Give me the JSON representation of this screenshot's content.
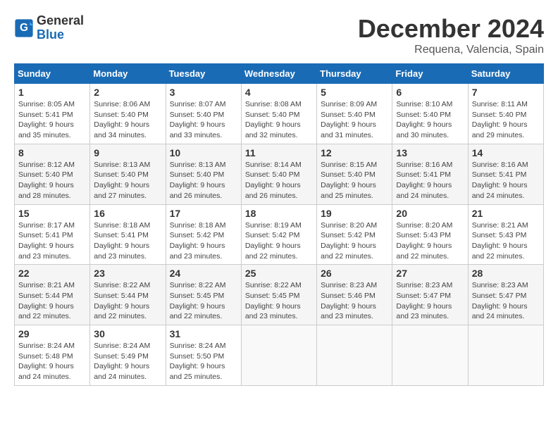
{
  "header": {
    "logo_line1": "General",
    "logo_line2": "Blue",
    "month_title": "December 2024",
    "location": "Requena, Valencia, Spain"
  },
  "calendar": {
    "days_of_week": [
      "Sunday",
      "Monday",
      "Tuesday",
      "Wednesday",
      "Thursday",
      "Friday",
      "Saturday"
    ],
    "weeks": [
      [
        {
          "day": "1",
          "sunrise": "8:05 AM",
          "sunset": "5:41 PM",
          "daylight": "9 hours and 35 minutes."
        },
        {
          "day": "2",
          "sunrise": "8:06 AM",
          "sunset": "5:40 PM",
          "daylight": "9 hours and 34 minutes."
        },
        {
          "day": "3",
          "sunrise": "8:07 AM",
          "sunset": "5:40 PM",
          "daylight": "9 hours and 33 minutes."
        },
        {
          "day": "4",
          "sunrise": "8:08 AM",
          "sunset": "5:40 PM",
          "daylight": "9 hours and 32 minutes."
        },
        {
          "day": "5",
          "sunrise": "8:09 AM",
          "sunset": "5:40 PM",
          "daylight": "9 hours and 31 minutes."
        },
        {
          "day": "6",
          "sunrise": "8:10 AM",
          "sunset": "5:40 PM",
          "daylight": "9 hours and 30 minutes."
        },
        {
          "day": "7",
          "sunrise": "8:11 AM",
          "sunset": "5:40 PM",
          "daylight": "9 hours and 29 minutes."
        }
      ],
      [
        {
          "day": "8",
          "sunrise": "8:12 AM",
          "sunset": "5:40 PM",
          "daylight": "9 hours and 28 minutes."
        },
        {
          "day": "9",
          "sunrise": "8:13 AM",
          "sunset": "5:40 PM",
          "daylight": "9 hours and 27 minutes."
        },
        {
          "day": "10",
          "sunrise": "8:13 AM",
          "sunset": "5:40 PM",
          "daylight": "9 hours and 26 minutes."
        },
        {
          "day": "11",
          "sunrise": "8:14 AM",
          "sunset": "5:40 PM",
          "daylight": "9 hours and 26 minutes."
        },
        {
          "day": "12",
          "sunrise": "8:15 AM",
          "sunset": "5:40 PM",
          "daylight": "9 hours and 25 minutes."
        },
        {
          "day": "13",
          "sunrise": "8:16 AM",
          "sunset": "5:41 PM",
          "daylight": "9 hours and 24 minutes."
        },
        {
          "day": "14",
          "sunrise": "8:16 AM",
          "sunset": "5:41 PM",
          "daylight": "9 hours and 24 minutes."
        }
      ],
      [
        {
          "day": "15",
          "sunrise": "8:17 AM",
          "sunset": "5:41 PM",
          "daylight": "9 hours and 23 minutes."
        },
        {
          "day": "16",
          "sunrise": "8:18 AM",
          "sunset": "5:41 PM",
          "daylight": "9 hours and 23 minutes."
        },
        {
          "day": "17",
          "sunrise": "8:18 AM",
          "sunset": "5:42 PM",
          "daylight": "9 hours and 23 minutes."
        },
        {
          "day": "18",
          "sunrise": "8:19 AM",
          "sunset": "5:42 PM",
          "daylight": "9 hours and 22 minutes."
        },
        {
          "day": "19",
          "sunrise": "8:20 AM",
          "sunset": "5:42 PM",
          "daylight": "9 hours and 22 minutes."
        },
        {
          "day": "20",
          "sunrise": "8:20 AM",
          "sunset": "5:43 PM",
          "daylight": "9 hours and 22 minutes."
        },
        {
          "day": "21",
          "sunrise": "8:21 AM",
          "sunset": "5:43 PM",
          "daylight": "9 hours and 22 minutes."
        }
      ],
      [
        {
          "day": "22",
          "sunrise": "8:21 AM",
          "sunset": "5:44 PM",
          "daylight": "9 hours and 22 minutes."
        },
        {
          "day": "23",
          "sunrise": "8:22 AM",
          "sunset": "5:44 PM",
          "daylight": "9 hours and 22 minutes."
        },
        {
          "day": "24",
          "sunrise": "8:22 AM",
          "sunset": "5:45 PM",
          "daylight": "9 hours and 22 minutes."
        },
        {
          "day": "25",
          "sunrise": "8:22 AM",
          "sunset": "5:45 PM",
          "daylight": "9 hours and 23 minutes."
        },
        {
          "day": "26",
          "sunrise": "8:23 AM",
          "sunset": "5:46 PM",
          "daylight": "9 hours and 23 minutes."
        },
        {
          "day": "27",
          "sunrise": "8:23 AM",
          "sunset": "5:47 PM",
          "daylight": "9 hours and 23 minutes."
        },
        {
          "day": "28",
          "sunrise": "8:23 AM",
          "sunset": "5:47 PM",
          "daylight": "9 hours and 24 minutes."
        }
      ],
      [
        {
          "day": "29",
          "sunrise": "8:24 AM",
          "sunset": "5:48 PM",
          "daylight": "9 hours and 24 minutes."
        },
        {
          "day": "30",
          "sunrise": "8:24 AM",
          "sunset": "5:49 PM",
          "daylight": "9 hours and 24 minutes."
        },
        {
          "day": "31",
          "sunrise": "8:24 AM",
          "sunset": "5:50 PM",
          "daylight": "9 hours and 25 minutes."
        },
        null,
        null,
        null,
        null
      ]
    ]
  }
}
